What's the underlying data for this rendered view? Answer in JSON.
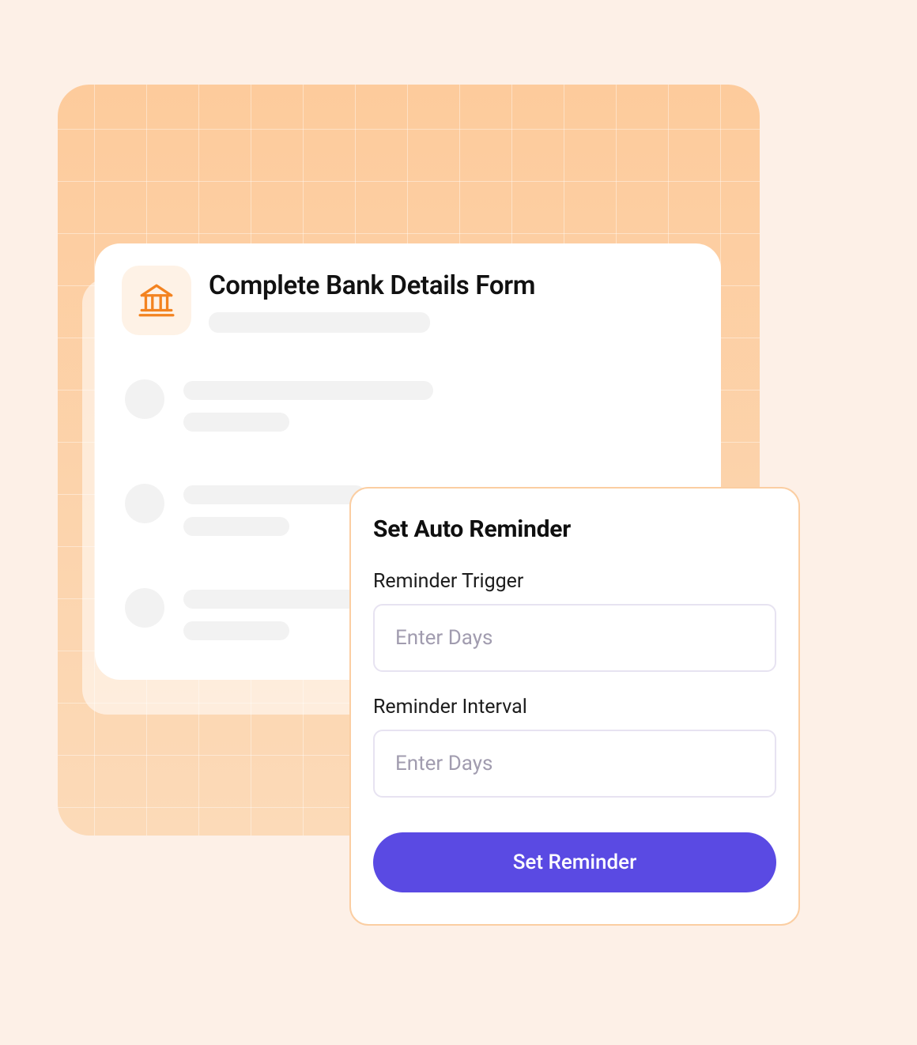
{
  "form_card": {
    "title": "Complete Bank Details Form",
    "icon": "bank-icon"
  },
  "reminder_card": {
    "title": "Set Auto Reminder",
    "fields": {
      "trigger": {
        "label": "Reminder Trigger",
        "placeholder": "Enter Days",
        "value": ""
      },
      "interval": {
        "label": "Reminder Interval",
        "placeholder": "Enter Days",
        "value": ""
      }
    },
    "submit_label": "Set Reminder"
  },
  "colors": {
    "accent_orange": "#F38320",
    "primary_purple": "#5A4AE3",
    "bg_peach": "#FDF0E7"
  }
}
